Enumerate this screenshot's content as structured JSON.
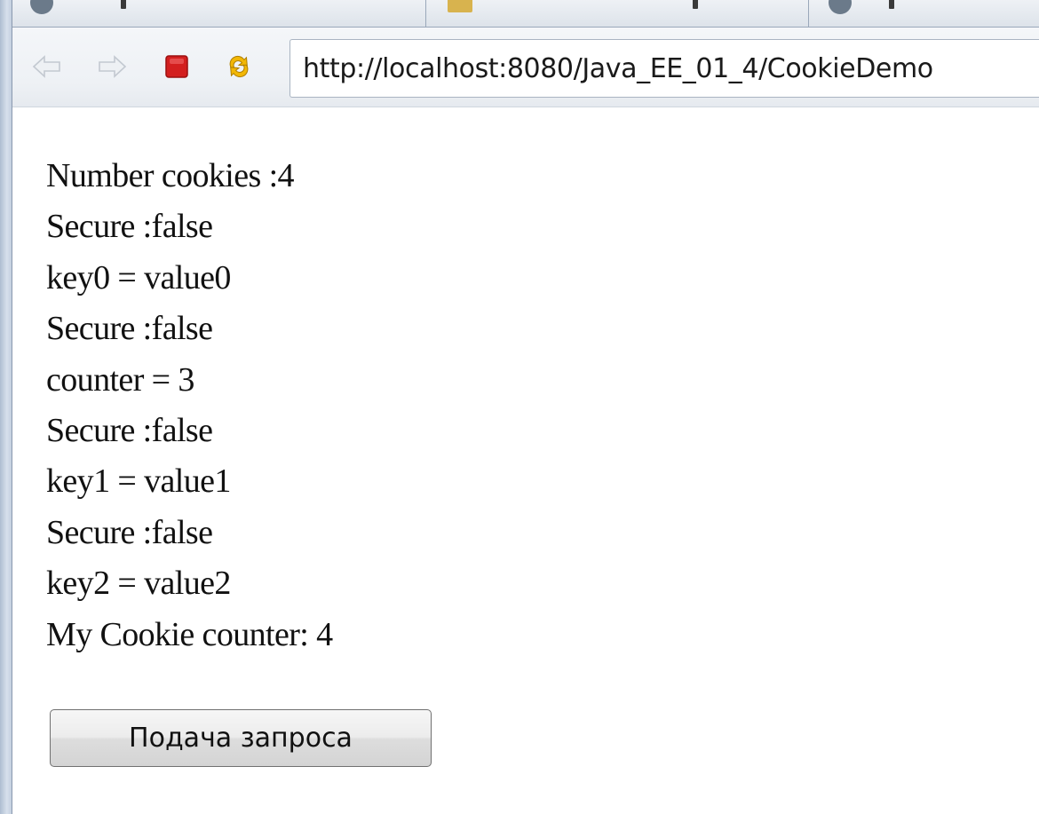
{
  "browser": {
    "address_url": "http://localhost:8080/Java_EE_01_4/CookieDemo",
    "nav_icons": [
      "back-arrow-icon",
      "forward-arrow-icon",
      "stop-icon",
      "refresh-icon"
    ],
    "colors": {
      "stop": "#e02020",
      "refresh": "#f0b400",
      "arrows_disabled": "#c9cfd6"
    }
  },
  "page": {
    "lines": [
      "Number cookies :4",
      "Secure :false",
      "key0 = value0",
      "Secure :false",
      "counter = 3",
      "Secure :false",
      "key1 = value1",
      "Secure :false",
      "key2 = value2",
      "My Cookie counter: 4"
    ],
    "submit_label": "Подача запроса"
  }
}
